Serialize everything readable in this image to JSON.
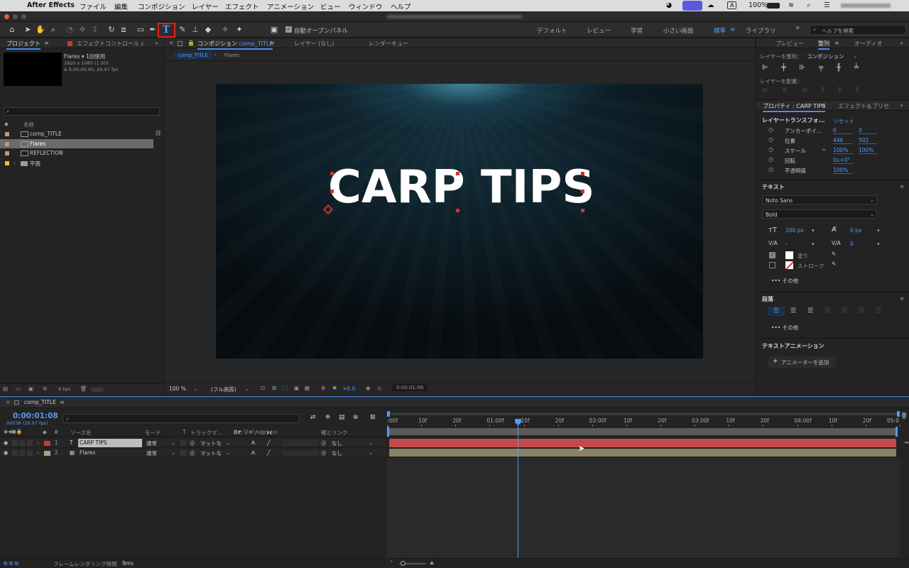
{
  "menubar": {
    "app": "After Effects",
    "items": [
      "ファイル",
      "編集",
      "コンポジション",
      "レイヤー",
      "エフェクト",
      "アニメーション",
      "ビュー",
      "ウィンドウ",
      "ヘルプ"
    ],
    "battery": "100%"
  },
  "toolbar": {
    "auto_open_label": "自動オープンパネル",
    "workspaces": [
      "デフォルト",
      "レビュー",
      "学習",
      "小さい画面",
      "標準",
      "ライブラリ"
    ],
    "active_workspace": "標準",
    "help_placeholder": "ヘルプを検索"
  },
  "project": {
    "tab_project": "プロジェクト",
    "tab_effects": "エフェクトコントロール c",
    "selected_name": "Flares ▾ 1回使用",
    "selected_dims": "1920 x 1080 (1.00)",
    "selected_dur": "Δ 0;00;05;00, 29.97 fps",
    "col_name": "名前",
    "items": [
      {
        "name": "comp_TITLE",
        "color": "#b59d7a"
      },
      {
        "name": "Flares",
        "color": "#b59d7a"
      },
      {
        "name": "REFLECTION",
        "color": "#b59d7a"
      },
      {
        "name": "平面",
        "color": "#e3c530"
      }
    ],
    "bpc": "8 bpc"
  },
  "viewer": {
    "tab_comp": "コンポジション",
    "comp_name": "comp_TITLE",
    "tab_layer": "レイヤー (なし)",
    "tab_render": "レンダーキュー",
    "breadcrumb_1": "comp_TITLE",
    "breadcrumb_2": "Flares",
    "title_text": "CARP TIPS",
    "zoom": "100 %",
    "quality": "(フル画質)",
    "exposure": "+0.0",
    "timecode": "0:00:01:08"
  },
  "right": {
    "tab_preview": "プレビュー",
    "tab_align": "整列",
    "tab_audio": "オーディオ",
    "align_to_label": "レイヤーを整列：",
    "align_to_value": "コンポジション",
    "distribute_label": "レイヤーを配置：",
    "props_tab": "プロパティ : CARP TIPS",
    "effects_tab": "エフェクト＆プリセ",
    "transform_title": "レイヤートランスフォ...",
    "reset": "リセット",
    "props": [
      {
        "label": "アンカーポイ...",
        "v1": "0",
        "v2": "0"
      },
      {
        "label": "位置",
        "v1": "446",
        "v2": "502"
      },
      {
        "label": "スケール",
        "v1": "100%",
        "v2": "100%"
      },
      {
        "label": "回転",
        "v1": "0x+0°",
        "v2": ""
      },
      {
        "label": "不透明度",
        "v1": "100%",
        "v2": ""
      }
    ],
    "text_title": "テキスト",
    "font": "Noto Sans",
    "style": "Bold",
    "size": "200 px",
    "leading": "0 px",
    "kerning": "-",
    "tracking": "0",
    "fill": "塗り",
    "stroke": "ストローク",
    "more": "その他",
    "para_title": "段落",
    "anim_title": "テキストアニメーション",
    "add_animator": "アニメーターを追加"
  },
  "timeline": {
    "tab": "comp_TITLE",
    "timecode": "0:00:01:08",
    "frames": "00038 (29.97 fps)",
    "col_source": "ソース名",
    "col_mode": "モード",
    "col_t": "T",
    "col_track": "トラックマ...",
    "col_parent": "親とリンク",
    "layers": [
      {
        "num": "1",
        "name": "CARP TIPS",
        "type": "T",
        "color": "#c43a3a",
        "mode": "通常",
        "matte": "マットな",
        "parent": "なし"
      },
      {
        "num": "2",
        "name": "Flares",
        "type": "▦",
        "color": "#b59d7a",
        "mode": "通常",
        "matte": "マットな",
        "parent": "なし"
      }
    ],
    "ruler": [
      ":00f",
      "10f",
      "20f",
      "01:00f",
      "10f",
      "20f",
      "02:00f",
      "10f",
      "20f",
      "03:00f",
      "10f",
      "20f",
      "04:00f",
      "10f",
      "20f",
      "05:0"
    ],
    "status_label": "フレームレンダリング時間",
    "status_value": "9ms"
  },
  "colors": {
    "accent": "#4b8ef0",
    "layer1_bar": "#c24a4a",
    "layer2_bar": "#8a8066",
    "highlight_box": "#e0201e"
  }
}
